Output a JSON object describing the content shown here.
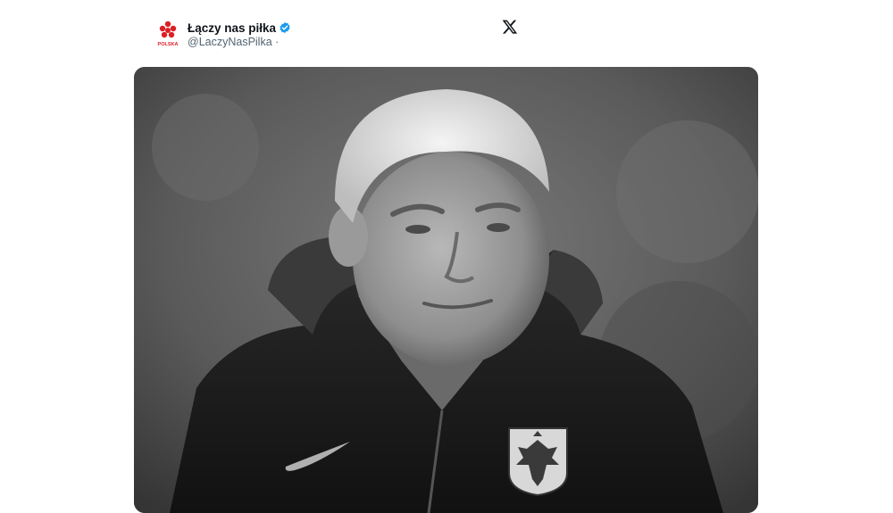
{
  "tweet": {
    "display_name": "Łączy nas piłka",
    "handle": "@LaczyNasPilka",
    "handle_separator": "·",
    "verified": true,
    "avatar_icon": "pzpn-logo-icon",
    "avatar_text": "POLSKA",
    "platform_icon": "x-logo-icon"
  },
  "media": {
    "type": "photo",
    "style": "black-and-white",
    "icons": [
      "nike-swoosh-icon",
      "polish-eagle-crest-icon"
    ]
  },
  "colors": {
    "name": "#0f1419",
    "handle": "#536471",
    "verified": "#1d9bf0",
    "logo_red": "#dc1f26"
  }
}
